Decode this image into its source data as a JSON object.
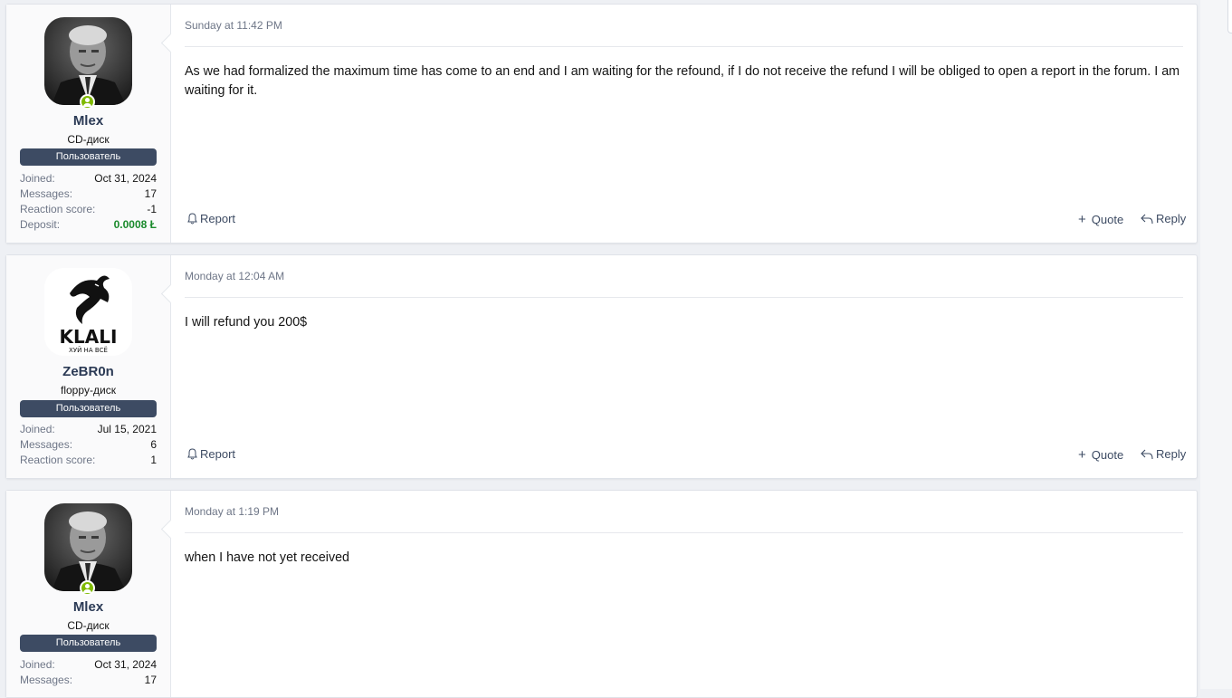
{
  "posts": [
    {
      "user": {
        "name": "Mlex",
        "title": "CD-диск",
        "role": "Пользователь",
        "avatar": "avatar-photo-elderly-man",
        "online": true,
        "stats": [
          {
            "label": "Joined:",
            "value": "Oct 31, 2024"
          },
          {
            "label": "Messages:",
            "value": "17"
          },
          {
            "label": "Reaction score:",
            "value": "-1"
          },
          {
            "label": "Deposit:",
            "value": "0.0008 Ł",
            "color": "#1a8a2c"
          }
        ]
      },
      "date": "Sunday at 11:42 PM",
      "body": "As we had formalized the maximum time has come to an end and I am waiting for the refound, if I do not receive the refund I will be obliged to open a report in the forum. I am waiting for it.",
      "actions": {
        "report": "Report",
        "quote": "Quote",
        "reply": "Reply"
      }
    },
    {
      "user": {
        "name": "ZeBR0n",
        "title": "floppy-диск",
        "role": "Пользователь",
        "avatar": "avatar-kali-dragon-logo",
        "avatar_text": "KLALI",
        "avatar_subtext": "ХУЙ НА ВСЁ",
        "online": false,
        "stats": [
          {
            "label": "Joined:",
            "value": "Jul 15, 2021"
          },
          {
            "label": "Messages:",
            "value": "6"
          },
          {
            "label": "Reaction score:",
            "value": "1"
          }
        ]
      },
      "date": "Monday at 12:04 AM",
      "body": "I will refund you 200$",
      "actions": {
        "report": "Report",
        "quote": "Quote",
        "reply": "Reply"
      }
    },
    {
      "user": {
        "name": "Mlex",
        "title": "CD-диск",
        "role": "Пользователь",
        "avatar": "avatar-photo-elderly-man",
        "online": true,
        "stats": [
          {
            "label": "Joined:",
            "value": "Oct 31, 2024"
          },
          {
            "label": "Messages:",
            "value": "17"
          }
        ]
      },
      "date": "Monday at 1:19 PM",
      "body": "when I have not yet received"
    }
  ],
  "colors": {
    "page_bg": "#eef0f4",
    "username": "#2b3a55",
    "role_badge": "#3d4b63",
    "online": "#7fb900",
    "deposit": "#1a8a2c"
  }
}
